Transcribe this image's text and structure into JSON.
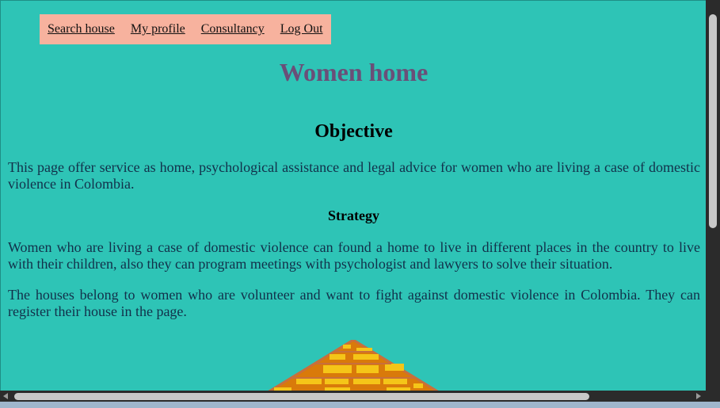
{
  "nav": {
    "items": [
      {
        "label": "Search house"
      },
      {
        "label": "My profile"
      },
      {
        "label": "Consultancy"
      },
      {
        "label": "Log Out"
      }
    ]
  },
  "main": {
    "title": "Women home",
    "objective_heading": "Objective",
    "objective_text": "This page offer service as home, psychological assistance and legal advice for women who are living a case of domestic violence in Colombia.",
    "strategy_heading": "Strategy",
    "strategy_text_1": "Women who are living a case of domestic violence can found a home to live in different places in the country to live with their children, also they can program meetings with psychologist and lawyers to solve their situation.",
    "strategy_text_2": "The houses belong to women who are volunteer and want to fight against domestic violence in Colombia. They can register their house in the page."
  },
  "colors": {
    "background": "#2ec4b6",
    "nav_background": "#f7b29e",
    "title": "#6a4f78",
    "roof_fill": "#d97a0a",
    "roof_tiles": "#f5c518"
  },
  "icons": {
    "roof": "house-roof-image"
  }
}
